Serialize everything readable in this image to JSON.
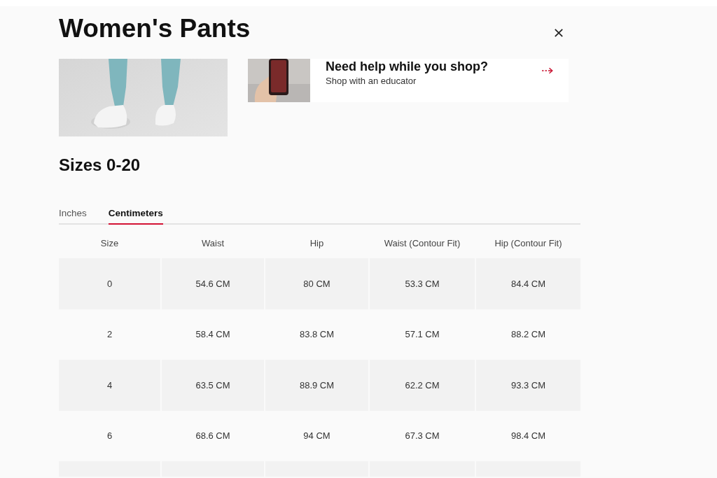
{
  "dialog": {
    "title": "Women's Pants"
  },
  "promo": {
    "title": "Need help while you shop?",
    "subtitle": "Shop with an educator"
  },
  "size_range_title": "Sizes 0-20",
  "unit_tabs": [
    {
      "label": "Inches",
      "selected": false
    },
    {
      "label": "Centimeters",
      "selected": true
    }
  ],
  "table": {
    "columns": [
      "Size",
      "Waist",
      "Hip",
      "Waist (Contour Fit)",
      "Hip (Contour Fit)"
    ],
    "rows": [
      [
        "0",
        "54.6 CM",
        "80 CM",
        "53.3 CM",
        "84.4 CM"
      ],
      [
        "2",
        "58.4 CM",
        "83.8 CM",
        "57.1 CM",
        "88.2 CM"
      ],
      [
        "4",
        "63.5 CM",
        "88.9 CM",
        "62.2 CM",
        "93.3 CM"
      ],
      [
        "6",
        "68.6 CM",
        "94 CM",
        "67.3 CM",
        "98.4 CM"
      ]
    ]
  }
}
